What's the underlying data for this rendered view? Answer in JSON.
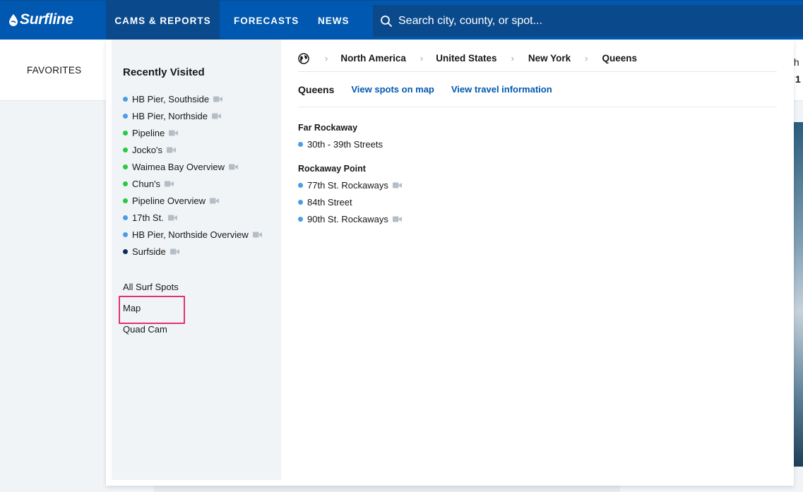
{
  "colors": {
    "brand": "#0058b0",
    "highlight": "#e2336b",
    "dot_blue": "#4a9be8",
    "dot_green": "#2cc745",
    "dot_navy": "#0d2f5c"
  },
  "header": {
    "logo": "Surfline",
    "nav": [
      "CAMS & REPORTS",
      "FORECASTS",
      "NEWS"
    ],
    "search_placeholder": "Search city, county, or spot..."
  },
  "page": {
    "favorites": "FAVORITES",
    "peek_top": "th",
    "peek_bottom": "1"
  },
  "sidebar": {
    "title": "Recently Visited",
    "recent": [
      {
        "name": "HB Pier, Southside",
        "status": "blue",
        "cam": true
      },
      {
        "name": "HB Pier, Northside",
        "status": "blue",
        "cam": true
      },
      {
        "name": "Pipeline",
        "status": "green",
        "cam": true
      },
      {
        "name": "Jocko's",
        "status": "green",
        "cam": true
      },
      {
        "name": "Waimea Bay Overview",
        "status": "green",
        "cam": true
      },
      {
        "name": "Chun's",
        "status": "green",
        "cam": true
      },
      {
        "name": "Pipeline Overview",
        "status": "green",
        "cam": true
      },
      {
        "name": "17th St.",
        "status": "blue",
        "cam": true
      },
      {
        "name": "HB Pier, Northside Overview",
        "status": "blue",
        "cam": true
      },
      {
        "name": "Surfside",
        "status": "navy",
        "cam": true
      }
    ],
    "links": [
      "All Surf Spots",
      "Map",
      "Quad Cam"
    ]
  },
  "breadcrumb": [
    "North America",
    "United States",
    "New York",
    "Queens"
  ],
  "region": {
    "title": "Queens",
    "links": [
      "View spots on map",
      "View travel information"
    ],
    "groups": [
      {
        "name": "Far Rockaway",
        "spots": [
          {
            "name": "30th - 39th Streets",
            "status": "blue",
            "cam": false
          }
        ]
      },
      {
        "name": "Rockaway Point",
        "spots": [
          {
            "name": "77th St. Rockaways",
            "status": "blue",
            "cam": true
          },
          {
            "name": "84th Street",
            "status": "blue",
            "cam": false
          },
          {
            "name": "90th St. Rockaways",
            "status": "blue",
            "cam": true
          }
        ]
      }
    ]
  }
}
